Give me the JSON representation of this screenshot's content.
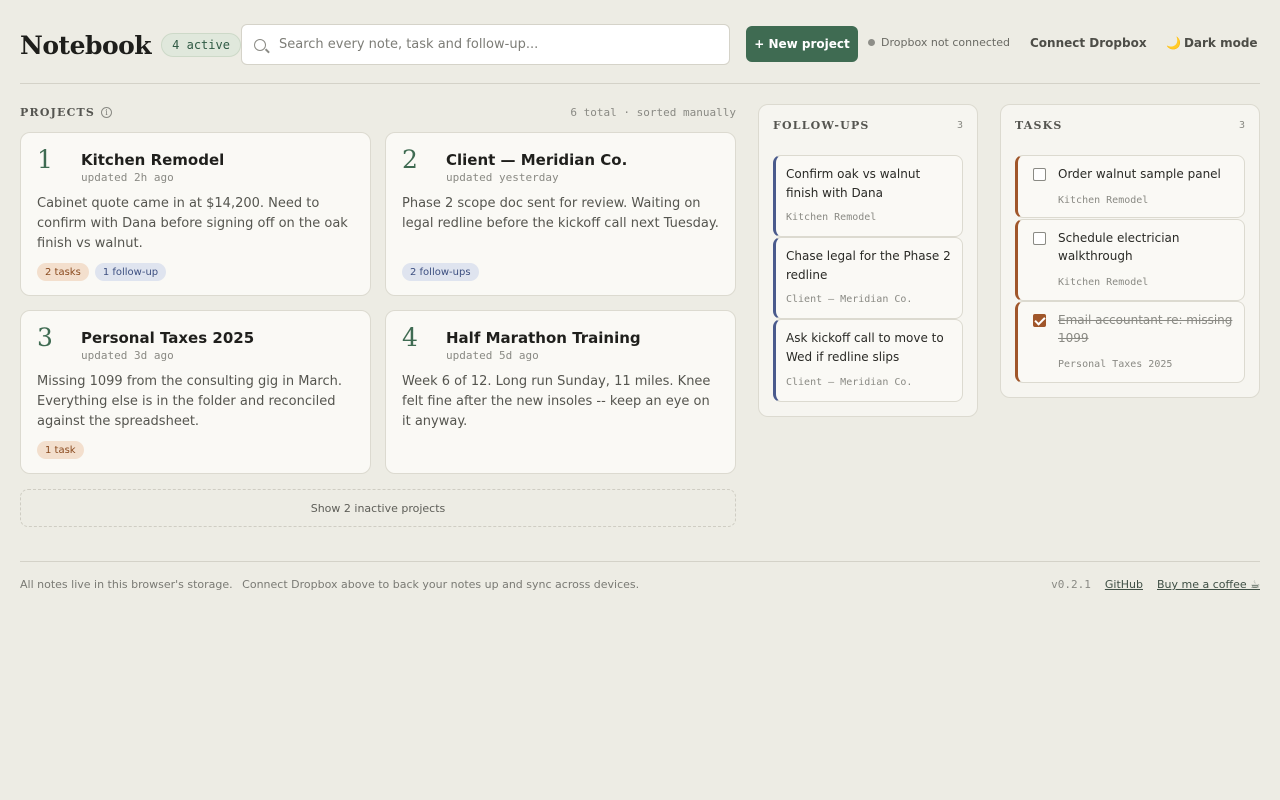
{
  "header": {
    "brand": "Notebook",
    "active_badge": "4 active",
    "search_placeholder": "Search every note, task and follow-up...",
    "search_value": "",
    "new_project_label": "+ New project",
    "dropbox_status": "Dropbox not connected",
    "connect_label": "Connect Dropbox",
    "dark_mode_label": "Dark mode",
    "dark_mode_icon": "🌙"
  },
  "projects": {
    "heading": "PROJECTS",
    "info_glyph": "i",
    "meta": "6 total · sorted manually",
    "show_inactive_label": "Show 2 inactive projects",
    "cards": [
      {
        "num": "1",
        "title": "Kitchen Remodel",
        "updated": "updated 2h ago",
        "body": "Cabinet quote came in at $14,200. Need to confirm with Dana before signing off on the oak finish vs walnut.",
        "tags": [
          {
            "label": "2 tasks",
            "kind": "task"
          },
          {
            "label": "1 follow-up",
            "kind": "follow"
          }
        ]
      },
      {
        "num": "2",
        "title": "Client — Meridian Co.",
        "updated": "updated yesterday",
        "body": "Phase 2 scope doc sent for review. Waiting on legal redline before the kickoff call next Tuesday.",
        "tags": [
          {
            "label": "2 follow-ups",
            "kind": "follow"
          }
        ]
      },
      {
        "num": "3",
        "title": "Personal Taxes 2025",
        "updated": "updated 3d ago",
        "body": "Missing 1099 from the consulting gig in March. Everything else is in the folder and reconciled against the spreadsheet.",
        "tags": [
          {
            "label": "1 task",
            "kind": "task"
          }
        ]
      },
      {
        "num": "4",
        "title": "Half Marathon Training",
        "updated": "updated 5d ago",
        "body": "Week 6 of 12. Long run Sunday, 11 miles. Knee felt fine after the new insoles -- keep an eye on it anyway.",
        "tags": []
      }
    ]
  },
  "followups": {
    "heading": "FOLLOW-UPS",
    "count": "3",
    "items": [
      {
        "text": "Confirm oak vs walnut finish with Dana",
        "project": "Kitchen Remodel"
      },
      {
        "text": "Chase legal for the Phase 2 redline",
        "project": "Client — Meridian Co."
      },
      {
        "text": "Ask kickoff call to move to Wed if redline slips",
        "project": "Client — Meridian Co."
      }
    ]
  },
  "tasks": {
    "heading": "TASKS",
    "count": "3",
    "items": [
      {
        "text": "Order walnut sample panel",
        "project": "Kitchen Remodel",
        "done": false
      },
      {
        "text": "Schedule electrician walkthrough",
        "project": "Kitchen Remodel",
        "done": false
      },
      {
        "text": "Email accountant re: missing 1099",
        "project": "Personal Taxes 2025",
        "done": true
      }
    ]
  },
  "footer": {
    "storage_note": "All notes live in this browser's storage.",
    "dropbox_note": "Connect Dropbox above to back your notes up and sync across devices.",
    "version": "v0.2.1",
    "github_label": "GitHub",
    "coffee_label": "Buy me a coffee ☕"
  },
  "colors": {
    "accent": "#3f6b52",
    "followup_accent": "#4a5a8c",
    "task_accent": "#a0562a",
    "background": "#edece4"
  }
}
